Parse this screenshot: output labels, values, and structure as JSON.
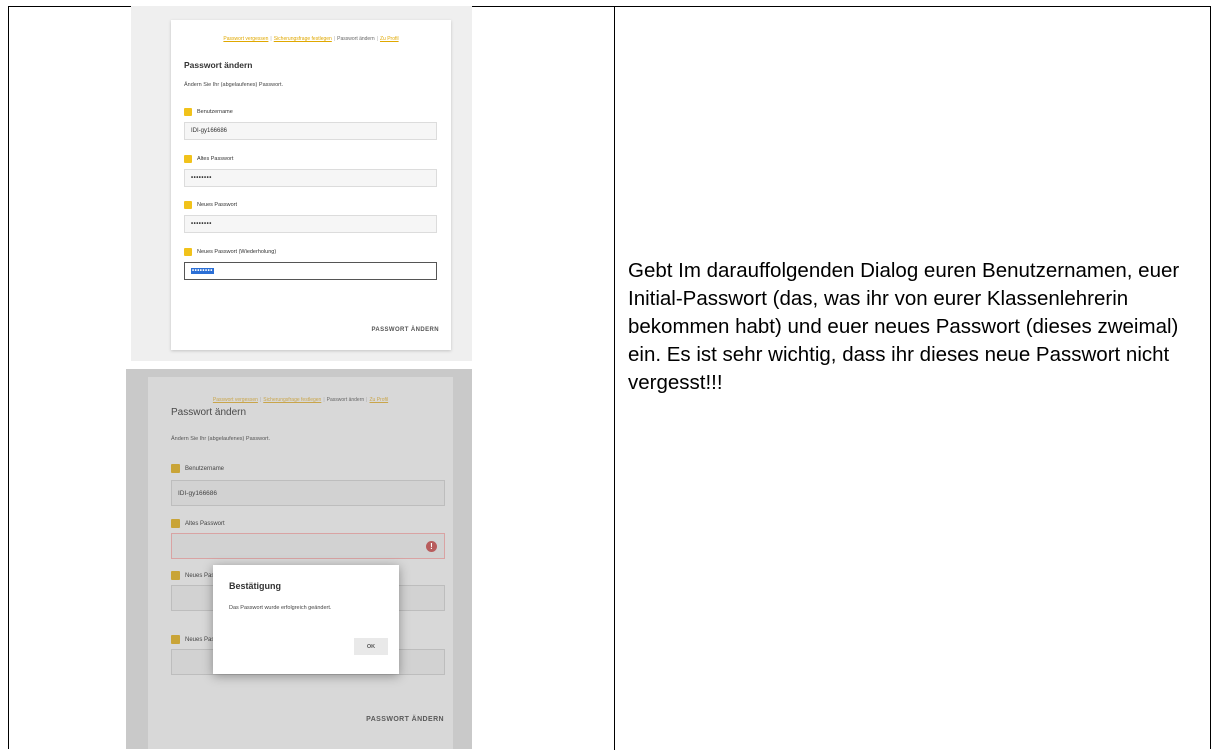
{
  "screenshot1": {
    "nav": [
      "Passwort vergessen",
      "Sicherungsfrage festlegen",
      "Passwort ändern",
      "Zu Profil"
    ],
    "title": "Passwort ändern",
    "intro": "Ändern Sie Ihr (abgelaufenes) Passwort.",
    "fields": [
      {
        "label": "Benutzername",
        "value": "IDI-gy166686"
      },
      {
        "label": "Altes Passwort",
        "value": "••••••••"
      },
      {
        "label": "Neues Passwort",
        "value": "••••••••"
      },
      {
        "label": "Neues Passwort (Wiederholung)",
        "value": "••••••••"
      }
    ],
    "submit": "PASSWORT ÄNDERN"
  },
  "screenshot2": {
    "nav": [
      "Passwort vergessen",
      "Sicherungsfrage festlegen",
      "Passwort ändern",
      "Zu Profil"
    ],
    "title": "Passwort ändern",
    "intro": "Ändern Sie Ihr (abgelaufenes) Passwort.",
    "fields": [
      {
        "label": "Benutzername",
        "value": "IDI-gy166686"
      },
      {
        "label": "Altes Passwort",
        "value": ""
      },
      {
        "label": "Neues Passwort",
        "value": ""
      },
      {
        "label": "Neues Passwort (Wiederholung)",
        "value": ""
      }
    ],
    "error_icon": "!",
    "submit": "PASSWORT ÄNDERN",
    "dialog": {
      "title": "Bestätigung",
      "message": "Das Passwort wurde erfolgreich geändert.",
      "ok": "OK"
    }
  },
  "instructions": "Gebt Im darauffolgenden Dialog euren Benutzernamen, euer Initial-Passwort (das, was ihr von eurer Klassenlehrerin bekommen habt) und euer neues Passwort (dieses zweimal) ein. Es ist sehr wichtig, dass ihr dieses neue Passwort nicht vergesst!!!",
  "colors": {
    "accent": "#f1c21b",
    "selection": "#2b6fd6",
    "error": "#b85c5c"
  }
}
